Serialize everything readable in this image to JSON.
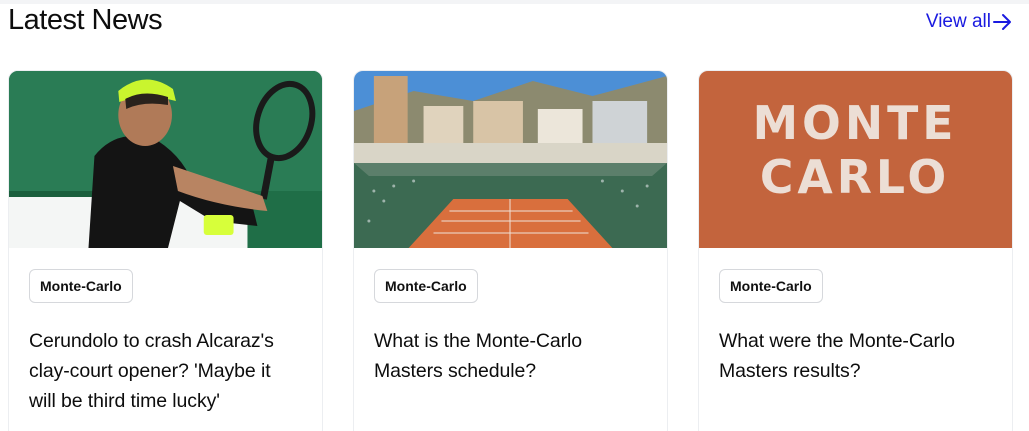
{
  "section": {
    "title": "Latest News",
    "view_all": "View all"
  },
  "colors": {
    "link": "#1a1ae0",
    "clay": "#c9673f",
    "court_green": "#2f7d4a"
  },
  "icons": {
    "view_all": "arrow-right-icon"
  },
  "cards": [
    {
      "tag": "Monte-Carlo",
      "headline": "Cerundolo to crash Alcaraz's clay-court opener? 'Maybe it will be third time lucky'",
      "image": "Player hitting backhand"
    },
    {
      "tag": "Monte-Carlo",
      "headline": "What is the Monte-Carlo Masters schedule?",
      "image": "Monte-Carlo stadium aerial view"
    },
    {
      "tag": "Monte-Carlo",
      "headline": "What were the Monte-Carlo Masters results?",
      "image": "MONTE CARLO painted on clay",
      "image_text": [
        "MONTE",
        "CARLO"
      ]
    }
  ]
}
